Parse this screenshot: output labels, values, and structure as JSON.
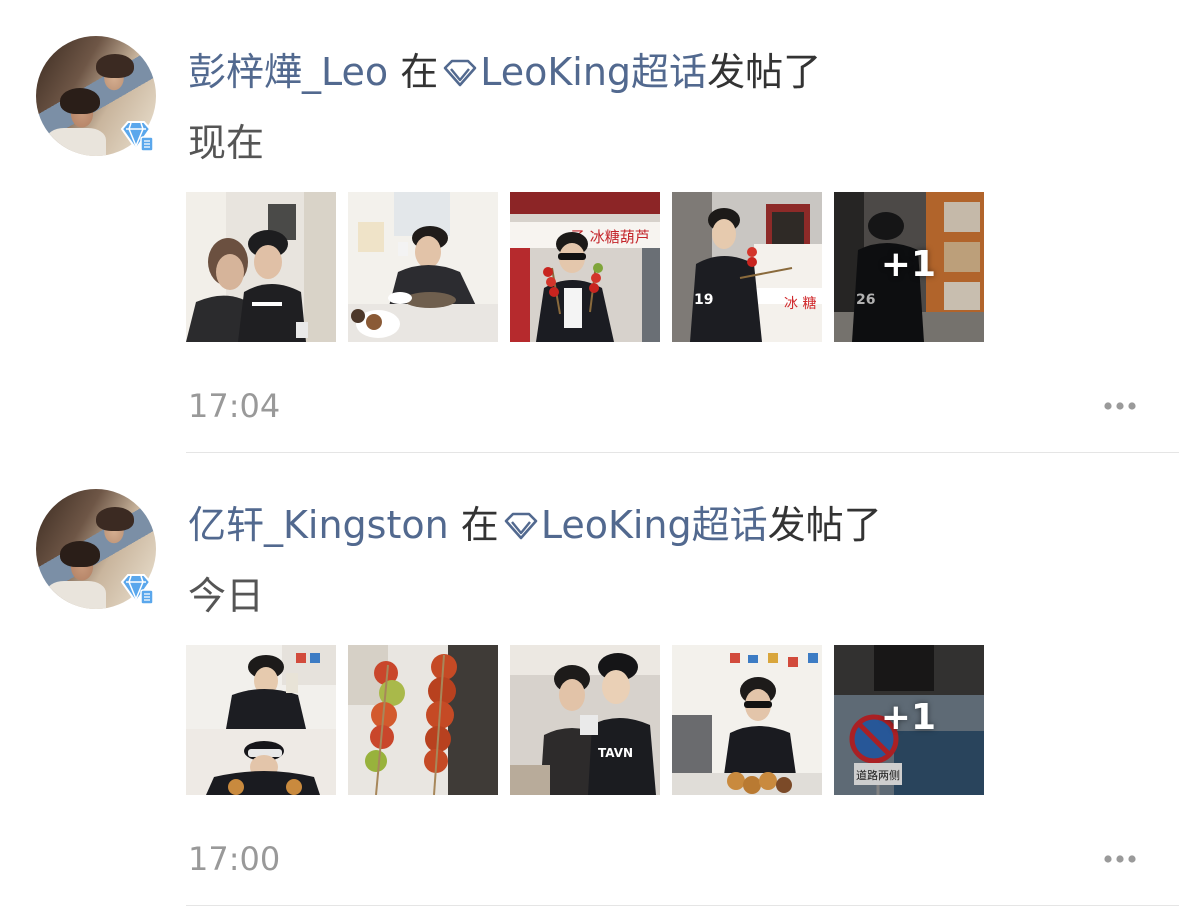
{
  "posts": [
    {
      "author": "彭梓燁_Leo",
      "connector": " 在",
      "topic": "LeoKing超话",
      "action": "发帖了",
      "body": "现在",
      "more_count": "+1",
      "time": "17:04"
    },
    {
      "author": "亿轩_Kingston",
      "connector": " 在",
      "topic": "LeoKing超话",
      "action": "发帖了",
      "body": "今日",
      "more_count": "+1",
      "time": "17:00"
    }
  ],
  "photo_signs": {
    "p1_sign_shop": "子 冰糖葫芦",
    "p1_sign_stall": "冰 糖",
    "p2_sign_road": "道路两侧"
  },
  "icons": {
    "topic": "diamond-icon",
    "avatar_badge": "diamond-badge-icon",
    "more": "more-dots-icon"
  },
  "colors": {
    "name_link": "#52698f",
    "text": "#333333",
    "secondary_text": "#999999",
    "divider": "#e5e5e5",
    "badge": "#5aa7ec"
  }
}
